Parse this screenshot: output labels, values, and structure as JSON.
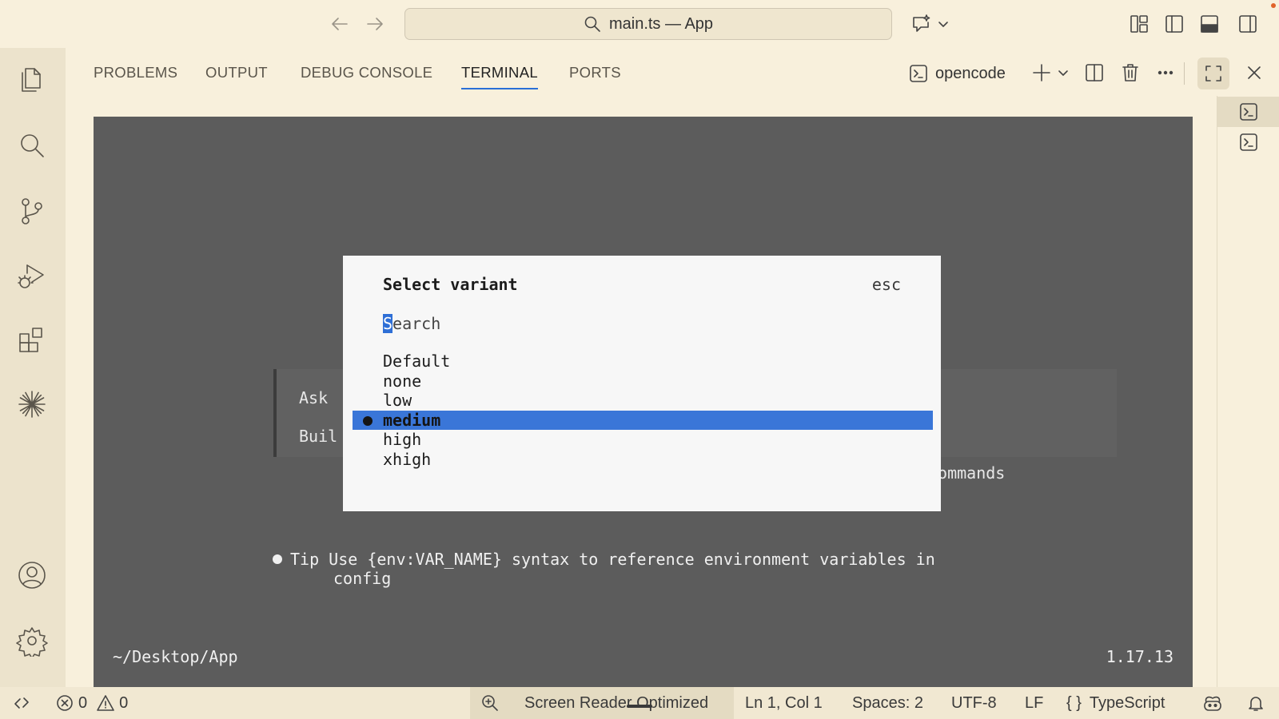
{
  "titlebar": {
    "command_center": "main.ts — App"
  },
  "panel": {
    "tabs": [
      {
        "label": "PROBLEMS"
      },
      {
        "label": "OUTPUT"
      },
      {
        "label": "DEBUG CONSOLE"
      },
      {
        "label": "TERMINAL",
        "active": true
      },
      {
        "label": "PORTS"
      }
    ],
    "terminal_name": "opencode"
  },
  "terminal": {
    "bg_line1": "Ask",
    "bg_line2": "Buil",
    "bg_commands": "commands",
    "tip_line1": "Tip Use {env:VAR_NAME} syntax to reference environment variables in",
    "tip_line2": "config",
    "cwd": "~/Desktop/App",
    "version": "1.17.13"
  },
  "dialog": {
    "title": "Select variant",
    "esc": "esc",
    "search_cursor": "S",
    "search_rest": "earch",
    "options": [
      "Default",
      "none",
      "low",
      "medium",
      "high",
      "xhigh"
    ],
    "selected": "medium"
  },
  "statusbar": {
    "errors": "0",
    "warnings": "0",
    "screen_reader": "Screen Reader Optimized",
    "cursor_pos": "Ln 1, Col 1",
    "spaces": "Spaces: 2",
    "encoding": "UTF-8",
    "eol": "LF",
    "language_braces": "{ }",
    "language": "TypeScript"
  },
  "colors": {
    "accent": "#2a6fd6",
    "selection": "#3a76d8",
    "terminal_bg": "#5c5c5c",
    "chrome_bg": "#f8f0dc"
  }
}
